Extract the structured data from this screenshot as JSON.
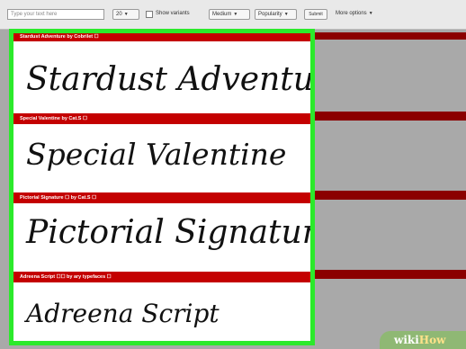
{
  "toolbar": {
    "preview_placeholder": "Type your text here",
    "size_value": "20",
    "variants_label": "Show variants",
    "weight_value": "Medium",
    "sort_value": "Popularity",
    "submit_label": "Submit",
    "more_options_label": "More options"
  },
  "fonts": [
    {
      "header": "Stardust Adventure by Cobrilet ☐",
      "sample": "Stardust Adventure"
    },
    {
      "header": "Special Valentine by Cat.S ☐",
      "sample": "Special Valentine"
    },
    {
      "header": "Pictorial Signature ☐ by Cat.S ☐",
      "sample": "Pictorial Signature"
    },
    {
      "header": "Adreena Script ☐☐ by ary typefaces ☐",
      "sample": "Adreena Script"
    }
  ],
  "colors": {
    "highlight": "#2bea2b",
    "header_bg": "#c40000",
    "right_band": "#8b0000",
    "background": "#a9a9a9"
  },
  "watermark": {
    "part1": "wiki",
    "part2": "How"
  }
}
